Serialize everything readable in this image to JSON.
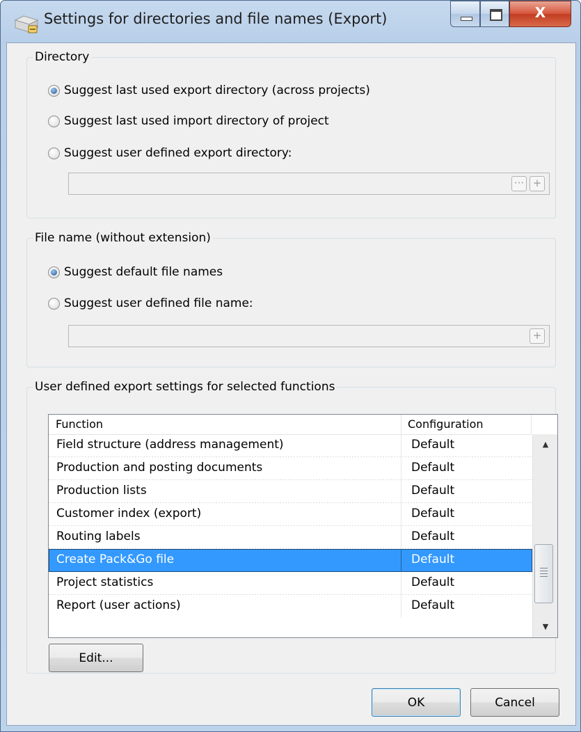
{
  "window": {
    "title": "Settings for directories and file names (Export)",
    "close_glyph": "X"
  },
  "directory": {
    "legend": "Directory",
    "options": [
      {
        "label": "Suggest last used export directory (across projects)",
        "checked": true
      },
      {
        "label": "Suggest last used import directory of project",
        "checked": false
      },
      {
        "label": "Suggest user defined export directory:",
        "checked": false
      }
    ],
    "path_value": "",
    "browse_label": "···",
    "add_label": "+"
  },
  "filename": {
    "legend": "File name (without extension)",
    "options": [
      {
        "label": "Suggest default file names",
        "checked": true
      },
      {
        "label": "Suggest user defined file name:",
        "checked": false
      }
    ],
    "name_value": "",
    "add_label": "+"
  },
  "functions": {
    "legend": "User defined export settings for selected functions",
    "columns": [
      "Function",
      "Configuration"
    ],
    "rows": [
      {
        "function": "Field structure (address management)",
        "configuration": "Default"
      },
      {
        "function": "Production and posting documents",
        "configuration": "Default"
      },
      {
        "function": "Production lists",
        "configuration": "Default"
      },
      {
        "function": "Customer index (export)",
        "configuration": "Default"
      },
      {
        "function": "Routing labels",
        "configuration": "Default"
      },
      {
        "function": "Create Pack&Go file",
        "configuration": "Default"
      },
      {
        "function": "Project statistics",
        "configuration": "Default"
      },
      {
        "function": "Report (user actions)",
        "configuration": "Default"
      }
    ],
    "selected_row": "Create Pack&Go file",
    "edit_label": "Edit..."
  },
  "footer": {
    "ok_label": "OK",
    "cancel_label": "Cancel"
  },
  "colors": {
    "selection": "#3399ff",
    "title_bar": "#c6d9ee",
    "close_button": "#c23d22"
  }
}
